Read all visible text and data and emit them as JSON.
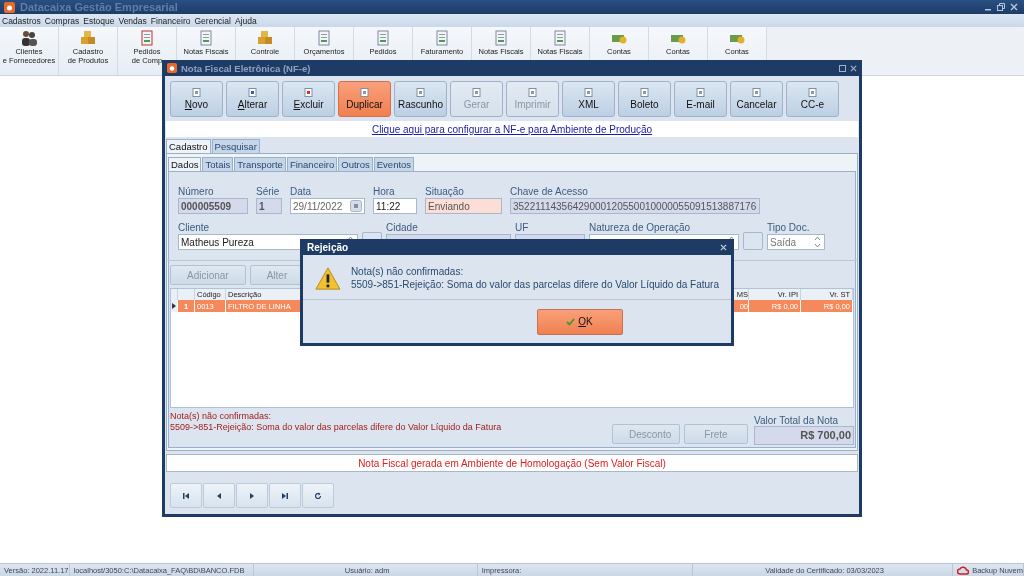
{
  "app": {
    "title": "Datacaixa Gestão Empresarial"
  },
  "menu": [
    "Cadastros",
    "Compras",
    "Estoque",
    "Vendas",
    "Financeiro",
    "Gerencial",
    "Ajuda"
  ],
  "toolbar": [
    {
      "lines": [
        "Clientes",
        "e Fornecedores"
      ]
    },
    {
      "lines": [
        "Cadastro",
        "de Produtos"
      ]
    },
    {
      "lines": [
        "Pedidos",
        "de Comp"
      ]
    },
    {
      "lines": [
        "Notas Fiscais"
      ]
    },
    {
      "lines": [
        "Controle"
      ]
    },
    {
      "lines": [
        "Orçamentos"
      ]
    },
    {
      "lines": [
        "Pedidos"
      ]
    },
    {
      "lines": [
        "Faturamento"
      ]
    },
    {
      "lines": [
        "Notas Fiscais"
      ]
    },
    {
      "lines": [
        "Notas Fiscais"
      ]
    },
    {
      "lines": [
        "Contas"
      ]
    },
    {
      "lines": [
        "Contas"
      ]
    },
    {
      "lines": [
        "Contas"
      ]
    }
  ],
  "nfe_window": {
    "title": "Nota Fiscal Eletrônica (NF-e)",
    "actions": [
      {
        "label": "Novo",
        "underlined_first": true,
        "selected": false,
        "disabled": false
      },
      {
        "label": "Alterar",
        "underlined_first": true,
        "selected": false,
        "disabled": false
      },
      {
        "label": "Excluir",
        "underlined_first": true,
        "selected": false,
        "disabled": false
      },
      {
        "label": "Duplicar",
        "underlined_first": false,
        "selected": true,
        "disabled": false
      },
      {
        "label": "Rascunho",
        "underlined_first": false,
        "selected": false,
        "disabled": false
      },
      {
        "label": "Gerar",
        "underlined_first": false,
        "selected": false,
        "disabled": true
      },
      {
        "label": "Imprimir",
        "underlined_first": false,
        "selected": false,
        "disabled": true
      },
      {
        "label": "XML",
        "underlined_first": false,
        "selected": false,
        "disabled": false
      },
      {
        "label": "Boleto",
        "underlined_first": false,
        "selected": false,
        "disabled": false
      },
      {
        "label": "E-mail",
        "underlined_first": false,
        "selected": false,
        "disabled": false
      },
      {
        "label": "Cancelar",
        "underlined_first": false,
        "selected": false,
        "disabled": false
      },
      {
        "label": "CC-e",
        "underlined_first": false,
        "selected": false,
        "disabled": false
      }
    ],
    "config_link": "Clique aqui para configurar a NF-e para Ambiente de Produção",
    "tabs": [
      {
        "label": "Cadastro",
        "selected": true
      },
      {
        "label": "Pesquisar",
        "selected": false
      }
    ],
    "subtabs": [
      {
        "label": "Dados",
        "selected": true
      },
      {
        "label": "Totais",
        "selected": false
      },
      {
        "label": "Transporte",
        "selected": false
      },
      {
        "label": "Financeiro",
        "selected": false
      },
      {
        "label": "Outros",
        "selected": false
      },
      {
        "label": "Eventos",
        "selected": false
      }
    ],
    "fields_row1": [
      {
        "label": "Número",
        "value": "000005509",
        "kind": "readonly"
      },
      {
        "label": "Série",
        "value": "1",
        "kind": "readonly"
      },
      {
        "label": "Data",
        "value": "29/11/2022",
        "kind": "date"
      },
      {
        "label": "Hora",
        "value": "11:22",
        "kind": "text"
      },
      {
        "label": "Situação",
        "value": "Enviando",
        "kind": "status"
      },
      {
        "label": "Chave de Acesso",
        "value": "35221114356429000120550010000055091513887176",
        "kind": "key"
      }
    ],
    "fields_row2": [
      {
        "label": "Cliente",
        "value": "Matheus Pureza",
        "kind": "select"
      },
      {
        "label": "Cidade",
        "kind": "key"
      },
      {
        "label": "UF",
        "kind": "key"
      },
      {
        "label": "Natureza de Operação",
        "kind": "select"
      },
      {
        "label": "Tipo Doc.",
        "value": "Saída",
        "kind": "spin"
      }
    ],
    "item_buttons": [
      "Adicionar",
      "Alter"
    ],
    "grid": {
      "columns": [
        "Código",
        "Descrição",
        "MS",
        "Vr. IPI",
        "Vr. ST"
      ],
      "rows": [
        {
          "number": "1",
          "selected": true,
          "cells": [
            "0013",
            "FILTRO DE LINHA",
            "00",
            "R$ 0,00",
            "R$ 0,00"
          ]
        }
      ]
    },
    "error_lines": [
      "Nota(s) não confirmadas:",
      "5509->851-Rejeição: Soma do valor das parcelas difere do Valor Líquido da Fatura"
    ],
    "total_buttons": [
      {
        "label": "Desconto",
        "disabled": true
      },
      {
        "label": "Frete",
        "disabled": true
      }
    ],
    "total_label": "Valor Total da Nota",
    "total_value": "R$ 700,00",
    "environment_notice": "Nota Fiscal gerada em Ambiente de Homologação (Sem Valor Fiscal)"
  },
  "dialog": {
    "title": "Rejeição",
    "lines": [
      "Nota(s) não confirmadas:",
      "5509->851-Rejeição: Soma do valor das parcelas difere do Valor Líquido da Fatura"
    ],
    "ok": {
      "label": "OK",
      "underlined_first": true
    }
  },
  "status_bar": [
    "Versão: 2022.11.17",
    "localhost/3050:C:\\Datacaixa_FAQ\\BD\\BANCO.FDB",
    "Usuário: adm",
    "Impressora:",
    "Validade do Certificado: 03/03/2023",
    "Backup Nuvem"
  ]
}
